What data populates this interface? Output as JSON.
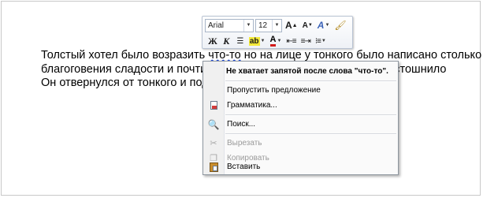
{
  "document": {
    "line1_before": "Толстый хотел было возразить ",
    "line1_error": "что-то",
    "line1_after": " но на лице у тонкого было написано столько",
    "line2_left": "благоговения сладости и почтитель",
    "line2_right": "стошнило",
    "line3_left": "Он отвернулся от тонкого и подал е"
  },
  "mini_toolbar": {
    "font_name": "Arial",
    "font_size": "12",
    "grow_font": "A",
    "shrink_font": "A",
    "bold": "Ж",
    "italic": "К",
    "font_color": "A",
    "highlight": "ab"
  },
  "context_menu": {
    "suggestion": "Не хватает запятой после слова \"что-то\".",
    "items": [
      {
        "label": "Пропустить предложение"
      },
      {
        "label": "Грамматика..."
      },
      {
        "label": "Поиск..."
      },
      {
        "label": "Вырезать"
      },
      {
        "label": "Копировать"
      },
      {
        "label": "Вставить"
      }
    ]
  }
}
